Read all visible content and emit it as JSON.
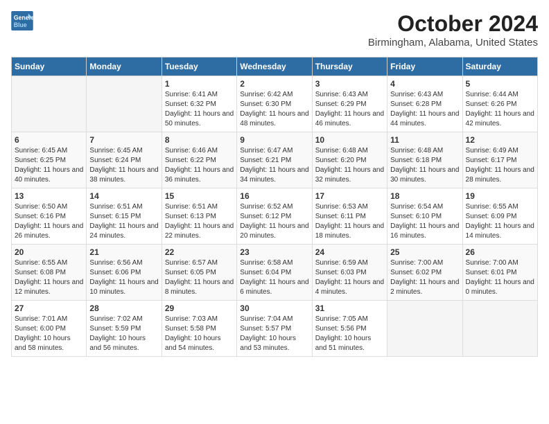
{
  "header": {
    "logo_line1": "General",
    "logo_line2": "Blue",
    "title": "October 2024",
    "subtitle": "Birmingham, Alabama, United States"
  },
  "weekdays": [
    "Sunday",
    "Monday",
    "Tuesday",
    "Wednesday",
    "Thursday",
    "Friday",
    "Saturday"
  ],
  "weeks": [
    [
      {
        "day": "",
        "info": ""
      },
      {
        "day": "",
        "info": ""
      },
      {
        "day": "1",
        "info": "Sunrise: 6:41 AM\nSunset: 6:32 PM\nDaylight: 11 hours and 50 minutes."
      },
      {
        "day": "2",
        "info": "Sunrise: 6:42 AM\nSunset: 6:30 PM\nDaylight: 11 hours and 48 minutes."
      },
      {
        "day": "3",
        "info": "Sunrise: 6:43 AM\nSunset: 6:29 PM\nDaylight: 11 hours and 46 minutes."
      },
      {
        "day": "4",
        "info": "Sunrise: 6:43 AM\nSunset: 6:28 PM\nDaylight: 11 hours and 44 minutes."
      },
      {
        "day": "5",
        "info": "Sunrise: 6:44 AM\nSunset: 6:26 PM\nDaylight: 11 hours and 42 minutes."
      }
    ],
    [
      {
        "day": "6",
        "info": "Sunrise: 6:45 AM\nSunset: 6:25 PM\nDaylight: 11 hours and 40 minutes."
      },
      {
        "day": "7",
        "info": "Sunrise: 6:45 AM\nSunset: 6:24 PM\nDaylight: 11 hours and 38 minutes."
      },
      {
        "day": "8",
        "info": "Sunrise: 6:46 AM\nSunset: 6:22 PM\nDaylight: 11 hours and 36 minutes."
      },
      {
        "day": "9",
        "info": "Sunrise: 6:47 AM\nSunset: 6:21 PM\nDaylight: 11 hours and 34 minutes."
      },
      {
        "day": "10",
        "info": "Sunrise: 6:48 AM\nSunset: 6:20 PM\nDaylight: 11 hours and 32 minutes."
      },
      {
        "day": "11",
        "info": "Sunrise: 6:48 AM\nSunset: 6:18 PM\nDaylight: 11 hours and 30 minutes."
      },
      {
        "day": "12",
        "info": "Sunrise: 6:49 AM\nSunset: 6:17 PM\nDaylight: 11 hours and 28 minutes."
      }
    ],
    [
      {
        "day": "13",
        "info": "Sunrise: 6:50 AM\nSunset: 6:16 PM\nDaylight: 11 hours and 26 minutes."
      },
      {
        "day": "14",
        "info": "Sunrise: 6:51 AM\nSunset: 6:15 PM\nDaylight: 11 hours and 24 minutes."
      },
      {
        "day": "15",
        "info": "Sunrise: 6:51 AM\nSunset: 6:13 PM\nDaylight: 11 hours and 22 minutes."
      },
      {
        "day": "16",
        "info": "Sunrise: 6:52 AM\nSunset: 6:12 PM\nDaylight: 11 hours and 20 minutes."
      },
      {
        "day": "17",
        "info": "Sunrise: 6:53 AM\nSunset: 6:11 PM\nDaylight: 11 hours and 18 minutes."
      },
      {
        "day": "18",
        "info": "Sunrise: 6:54 AM\nSunset: 6:10 PM\nDaylight: 11 hours and 16 minutes."
      },
      {
        "day": "19",
        "info": "Sunrise: 6:55 AM\nSunset: 6:09 PM\nDaylight: 11 hours and 14 minutes."
      }
    ],
    [
      {
        "day": "20",
        "info": "Sunrise: 6:55 AM\nSunset: 6:08 PM\nDaylight: 11 hours and 12 minutes."
      },
      {
        "day": "21",
        "info": "Sunrise: 6:56 AM\nSunset: 6:06 PM\nDaylight: 11 hours and 10 minutes."
      },
      {
        "day": "22",
        "info": "Sunrise: 6:57 AM\nSunset: 6:05 PM\nDaylight: 11 hours and 8 minutes."
      },
      {
        "day": "23",
        "info": "Sunrise: 6:58 AM\nSunset: 6:04 PM\nDaylight: 11 hours and 6 minutes."
      },
      {
        "day": "24",
        "info": "Sunrise: 6:59 AM\nSunset: 6:03 PM\nDaylight: 11 hours and 4 minutes."
      },
      {
        "day": "25",
        "info": "Sunrise: 7:00 AM\nSunset: 6:02 PM\nDaylight: 11 hours and 2 minutes."
      },
      {
        "day": "26",
        "info": "Sunrise: 7:00 AM\nSunset: 6:01 PM\nDaylight: 11 hours and 0 minutes."
      }
    ],
    [
      {
        "day": "27",
        "info": "Sunrise: 7:01 AM\nSunset: 6:00 PM\nDaylight: 10 hours and 58 minutes."
      },
      {
        "day": "28",
        "info": "Sunrise: 7:02 AM\nSunset: 5:59 PM\nDaylight: 10 hours and 56 minutes."
      },
      {
        "day": "29",
        "info": "Sunrise: 7:03 AM\nSunset: 5:58 PM\nDaylight: 10 hours and 54 minutes."
      },
      {
        "day": "30",
        "info": "Sunrise: 7:04 AM\nSunset: 5:57 PM\nDaylight: 10 hours and 53 minutes."
      },
      {
        "day": "31",
        "info": "Sunrise: 7:05 AM\nSunset: 5:56 PM\nDaylight: 10 hours and 51 minutes."
      },
      {
        "day": "",
        "info": ""
      },
      {
        "day": "",
        "info": ""
      }
    ]
  ]
}
